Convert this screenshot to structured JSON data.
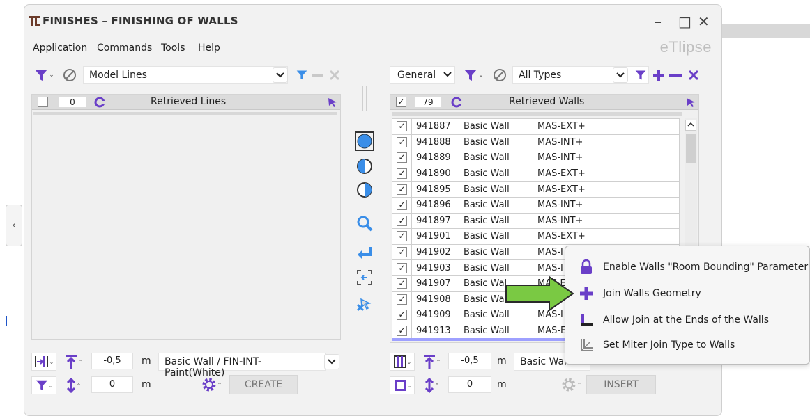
{
  "window": {
    "title": "FINISHES – FINISHING OF WALLS",
    "logo": "eTlipse",
    "controls": {
      "minimize": "–",
      "maximize": "□",
      "close": "✕"
    }
  },
  "menu": [
    "Application",
    "Commands",
    "Tools",
    "Help"
  ],
  "left": {
    "source_select": "Model Lines",
    "header": {
      "count": "0",
      "title": "Retrieved Lines",
      "checked": false
    },
    "offset_value": "-0,5",
    "offset_unit": "m",
    "type_select": "Basic Wall / FIN-INT-Paint(White)",
    "height_value": "0",
    "height_unit": "m",
    "create_button": "CREATE"
  },
  "right": {
    "category_select": "General",
    "types_select": "All Types",
    "header": {
      "count": "79",
      "title": "Retrieved Walls",
      "checked": true
    },
    "rows": [
      {
        "id": "941887",
        "family": "Basic Wall",
        "type": "MAS-EXT+"
      },
      {
        "id": "941888",
        "family": "Basic Wall",
        "type": "MAS-INT+"
      },
      {
        "id": "941889",
        "family": "Basic Wall",
        "type": "MAS-INT+"
      },
      {
        "id": "941890",
        "family": "Basic Wall",
        "type": "MAS-EXT+"
      },
      {
        "id": "941895",
        "family": "Basic Wall",
        "type": "MAS-EXT+"
      },
      {
        "id": "941896",
        "family": "Basic Wall",
        "type": "MAS-INT+"
      },
      {
        "id": "941897",
        "family": "Basic Wall",
        "type": "MAS-INT+"
      },
      {
        "id": "941901",
        "family": "Basic Wall",
        "type": "MAS-EXT+"
      },
      {
        "id": "941902",
        "family": "Basic Wall",
        "type": "MAS-I"
      },
      {
        "id": "941903",
        "family": "Basic Wall",
        "type": "MAS-I"
      },
      {
        "id": "941907",
        "family": "Basic Wal",
        "type": "MAS E"
      },
      {
        "id": "941908",
        "family": "Basic Wa",
        "type": ""
      },
      {
        "id": "941909",
        "family": "Basic Wall",
        "type": "MAS-I"
      },
      {
        "id": "941913",
        "family": "Basic Wall",
        "type": "MAS-E"
      }
    ],
    "offset_value": "-0,5",
    "offset_unit": "m",
    "type_select": "Basic Wal",
    "height_value": "0",
    "height_unit": "m",
    "insert_button": "INSERT"
  },
  "context_menu": [
    {
      "icon": "lock-icon",
      "label": "Enable Walls \"Room Bounding\" Parameter"
    },
    {
      "icon": "plus-icon",
      "label": "Join Walls Geometry"
    },
    {
      "icon": "corner-join-icon",
      "label": "Allow Join at the Ends of the Walls"
    },
    {
      "icon": "miter-join-icon",
      "label": "Set Miter Join Type to Walls"
    }
  ],
  "colors": {
    "accent_purple": "#6a3fc8",
    "accent_blue": "#3a8ee8",
    "arrow_green": "#7ac943"
  }
}
